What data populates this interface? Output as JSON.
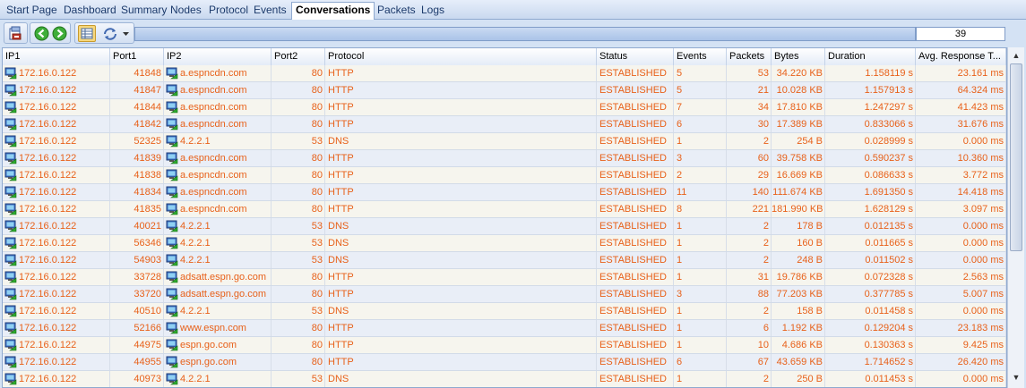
{
  "tabs": [
    {
      "label": "Start Page"
    },
    {
      "label": "Dashboard"
    },
    {
      "label": "Summary"
    },
    {
      "label": "Nodes"
    },
    {
      "label": "Protocol"
    },
    {
      "label": "Events"
    },
    {
      "label": "Conversations",
      "active": true
    },
    {
      "label": "Packets"
    },
    {
      "label": "Logs"
    }
  ],
  "toolbar": {
    "count": "39",
    "icons": [
      "export-icon",
      "back-icon",
      "forward-icon",
      "grid-view-icon",
      "network-refresh-icon",
      "dropdown-arrow-icon"
    ]
  },
  "columns": [
    "IP1",
    "Port1",
    "IP2",
    "Port2",
    "Protocol",
    "Status",
    "Events",
    "Packets",
    "Bytes",
    "Duration",
    "Avg. Response T..."
  ],
  "colors": {
    "value_text": "#e8611a",
    "accent": "#8fa9cf"
  },
  "rows": [
    {
      "ip1": "172.16.0.122",
      "port1": "41848",
      "ip2": "a.espncdn.com",
      "port2": "80",
      "protocol": "HTTP",
      "status": "ESTABLISHED",
      "events": "5",
      "packets": "53",
      "bytes": "34.220 KB",
      "duration": "1.158119 s",
      "avg": "23.161 ms"
    },
    {
      "ip1": "172.16.0.122",
      "port1": "41847",
      "ip2": "a.espncdn.com",
      "port2": "80",
      "protocol": "HTTP",
      "status": "ESTABLISHED",
      "events": "5",
      "packets": "21",
      "bytes": "10.028 KB",
      "duration": "1.157913 s",
      "avg": "64.324 ms"
    },
    {
      "ip1": "172.16.0.122",
      "port1": "41844",
      "ip2": "a.espncdn.com",
      "port2": "80",
      "protocol": "HTTP",
      "status": "ESTABLISHED",
      "events": "7",
      "packets": "34",
      "bytes": "17.810 KB",
      "duration": "1.247297 s",
      "avg": "41.423 ms"
    },
    {
      "ip1": "172.16.0.122",
      "port1": "41842",
      "ip2": "a.espncdn.com",
      "port2": "80",
      "protocol": "HTTP",
      "status": "ESTABLISHED",
      "events": "6",
      "packets": "30",
      "bytes": "17.389 KB",
      "duration": "0.833066 s",
      "avg": "31.676 ms"
    },
    {
      "ip1": "172.16.0.122",
      "port1": "52325",
      "ip2": "4.2.2.1",
      "port2": "53",
      "protocol": "DNS",
      "status": "ESTABLISHED",
      "events": "1",
      "packets": "2",
      "bytes": "254 B",
      "duration": "0.028999 s",
      "avg": "0.000 ms"
    },
    {
      "ip1": "172.16.0.122",
      "port1": "41839",
      "ip2": "a.espncdn.com",
      "port2": "80",
      "protocol": "HTTP",
      "status": "ESTABLISHED",
      "events": "3",
      "packets": "60",
      "bytes": "39.758 KB",
      "duration": "0.590237 s",
      "avg": "10.360 ms"
    },
    {
      "ip1": "172.16.0.122",
      "port1": "41838",
      "ip2": "a.espncdn.com",
      "port2": "80",
      "protocol": "HTTP",
      "status": "ESTABLISHED",
      "events": "2",
      "packets": "29",
      "bytes": "16.669 KB",
      "duration": "0.086633 s",
      "avg": "3.772 ms"
    },
    {
      "ip1": "172.16.0.122",
      "port1": "41834",
      "ip2": "a.espncdn.com",
      "port2": "80",
      "protocol": "HTTP",
      "status": "ESTABLISHED",
      "events": "11",
      "packets": "140",
      "bytes": "111.674 KB",
      "duration": "1.691350 s",
      "avg": "14.418 ms"
    },
    {
      "ip1": "172.16.0.122",
      "port1": "41835",
      "ip2": "a.espncdn.com",
      "port2": "80",
      "protocol": "HTTP",
      "status": "ESTABLISHED",
      "events": "8",
      "packets": "221",
      "bytes": "181.990 KB",
      "duration": "1.628129 s",
      "avg": "3.097 ms"
    },
    {
      "ip1": "172.16.0.122",
      "port1": "40021",
      "ip2": "4.2.2.1",
      "port2": "53",
      "protocol": "DNS",
      "status": "ESTABLISHED",
      "events": "1",
      "packets": "2",
      "bytes": "178 B",
      "duration": "0.012135 s",
      "avg": "0.000 ms"
    },
    {
      "ip1": "172.16.0.122",
      "port1": "56346",
      "ip2": "4.2.2.1",
      "port2": "53",
      "protocol": "DNS",
      "status": "ESTABLISHED",
      "events": "1",
      "packets": "2",
      "bytes": "160 B",
      "duration": "0.011665 s",
      "avg": "0.000 ms"
    },
    {
      "ip1": "172.16.0.122",
      "port1": "54903",
      "ip2": "4.2.2.1",
      "port2": "53",
      "protocol": "DNS",
      "status": "ESTABLISHED",
      "events": "1",
      "packets": "2",
      "bytes": "248 B",
      "duration": "0.011502 s",
      "avg": "0.000 ms"
    },
    {
      "ip1": "172.16.0.122",
      "port1": "33728",
      "ip2": "adsatt.espn.go.com",
      "port2": "80",
      "protocol": "HTTP",
      "status": "ESTABLISHED",
      "events": "1",
      "packets": "31",
      "bytes": "19.786 KB",
      "duration": "0.072328 s",
      "avg": "2.563 ms"
    },
    {
      "ip1": "172.16.0.122",
      "port1": "33720",
      "ip2": "adsatt.espn.go.com",
      "port2": "80",
      "protocol": "HTTP",
      "status": "ESTABLISHED",
      "events": "3",
      "packets": "88",
      "bytes": "77.203 KB",
      "duration": "0.377785 s",
      "avg": "5.007 ms"
    },
    {
      "ip1": "172.16.0.122",
      "port1": "40510",
      "ip2": "4.2.2.1",
      "port2": "53",
      "protocol": "DNS",
      "status": "ESTABLISHED",
      "events": "1",
      "packets": "2",
      "bytes": "158 B",
      "duration": "0.011458 s",
      "avg": "0.000 ms"
    },
    {
      "ip1": "172.16.0.122",
      "port1": "52166",
      "ip2": "www.espn.com",
      "port2": "80",
      "protocol": "HTTP",
      "status": "ESTABLISHED",
      "events": "1",
      "packets": "6",
      "bytes": "1.192 KB",
      "duration": "0.129204 s",
      "avg": "23.183 ms"
    },
    {
      "ip1": "172.16.0.122",
      "port1": "44975",
      "ip2": "espn.go.com",
      "port2": "80",
      "protocol": "HTTP",
      "status": "ESTABLISHED",
      "events": "1",
      "packets": "10",
      "bytes": "4.686 KB",
      "duration": "0.130363 s",
      "avg": "9.425 ms"
    },
    {
      "ip1": "172.16.0.122",
      "port1": "44955",
      "ip2": "espn.go.com",
      "port2": "80",
      "protocol": "HTTP",
      "status": "ESTABLISHED",
      "events": "6",
      "packets": "67",
      "bytes": "43.659 KB",
      "duration": "1.714652 s",
      "avg": "26.420 ms"
    },
    {
      "ip1": "172.16.0.122",
      "port1": "40973",
      "ip2": "4.2.2.1",
      "port2": "53",
      "protocol": "DNS",
      "status": "ESTABLISHED",
      "events": "1",
      "packets": "2",
      "bytes": "250 B",
      "duration": "0.011453 s",
      "avg": "0.000 ms"
    }
  ]
}
